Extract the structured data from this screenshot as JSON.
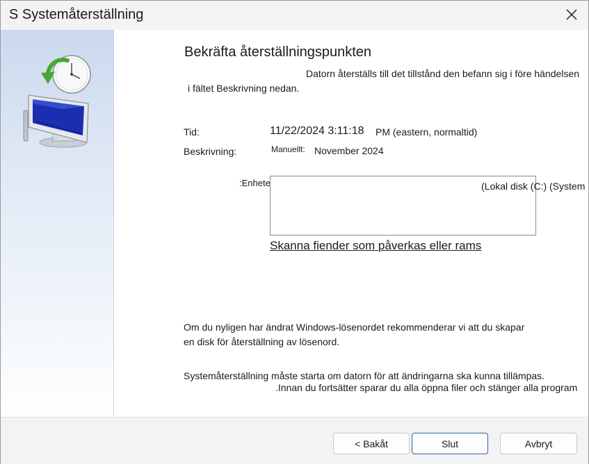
{
  "window": {
    "title": "S Systemåterställning",
    "close_icon": "close-icon"
  },
  "content": {
    "heading": "Bekräfta återställningspunkten",
    "intro_line1": "Datorn återställs till det tillstånd den befann sig i före händelsen",
    "intro_line2": "i fältet Beskrivning nedan.",
    "time_label": "Tid:",
    "time_value": "11/22/2024 3:11:18",
    "time_suffix": "PM (eastern, normaltid)",
    "description_label": "Beskrivning:",
    "description_prefix": "Manuellt:",
    "description_value": "November 2024",
    "drives_label": ":Enheter",
    "drives_value": "(Lokal disk (C:) (System",
    "scan_link": "Skanna fiender som påverkas eller rams",
    "password_line1": "Om du nyligen har ändrat Windows-lösenordet rekommenderar vi att du skapar",
    "password_line2": "en disk för återställning av lösenord.",
    "restart_line1": "Systemåterställning måste starta om datorn för att ändringarna ska kunna tillämpas.",
    "restart_line2": ".Innan du fortsätter sparar du alla öppna filer och stänger alla program"
  },
  "buttons": {
    "back": "< Bakåt",
    "finish": "Slut",
    "cancel": "Avbryt"
  },
  "icons": {
    "wizard": "system-restore-icon"
  }
}
